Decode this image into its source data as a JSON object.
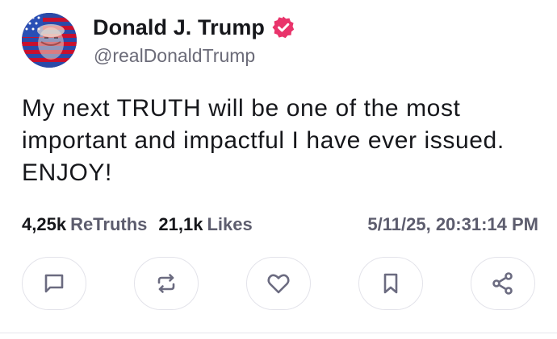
{
  "post": {
    "author": {
      "display_name": "Donald J. Trump",
      "handle": "@realDonaldTrump",
      "verified": true,
      "verified_color": "#e9346b"
    },
    "body": "My next TRUTH will be one of the most important and impactful I have ever issued. ENJOY!",
    "stats": {
      "retruths_count": "4,25k",
      "retruths_label": "ReTruths",
      "likes_count": "21,1k",
      "likes_label": "Likes"
    },
    "timestamp": "5/11/25, 20:31:14 PM"
  },
  "actions": [
    {
      "name": "reply",
      "icon": "comment-icon"
    },
    {
      "name": "retruth",
      "icon": "repost-icon"
    },
    {
      "name": "like",
      "icon": "heart-icon"
    },
    {
      "name": "bookmark",
      "icon": "bookmark-icon"
    },
    {
      "name": "share",
      "icon": "share-icon"
    }
  ],
  "colors": {
    "text": "#16171b",
    "muted": "#5d5d6e",
    "icon": "#6b6b80",
    "border": "#e3e3ea"
  }
}
